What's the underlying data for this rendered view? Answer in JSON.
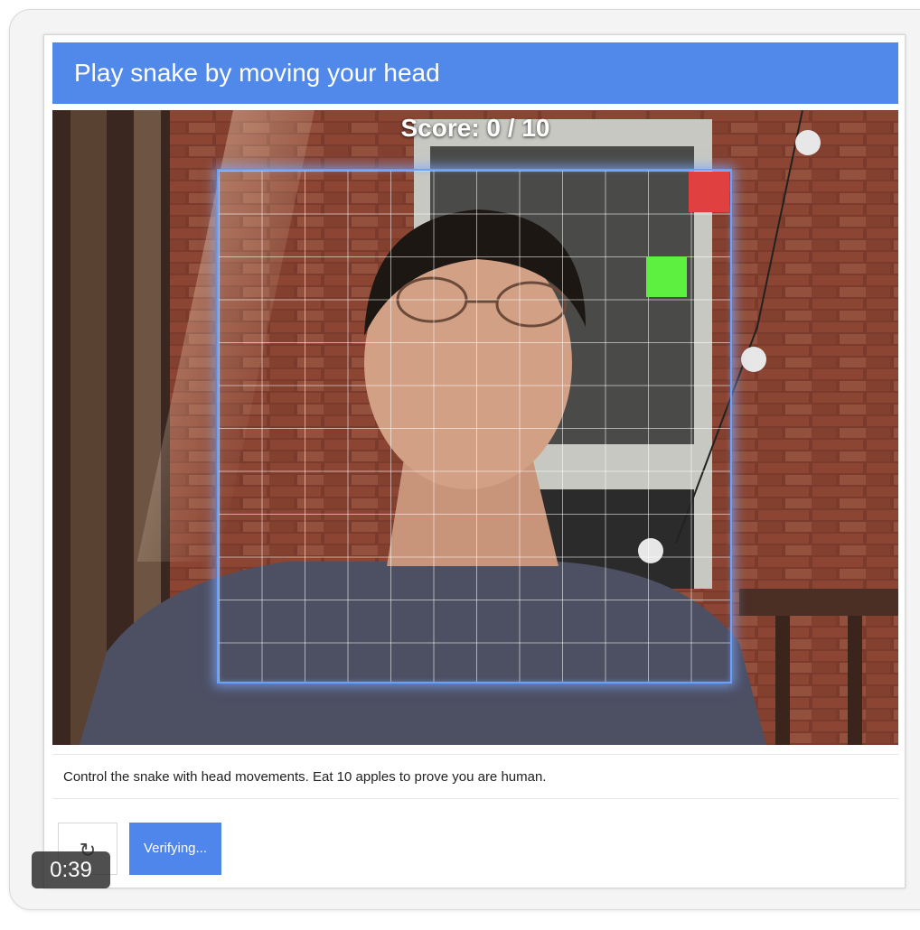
{
  "header": {
    "title": "Play snake by moving your head"
  },
  "game": {
    "score_text": "Score: 0 / 10",
    "score": 0,
    "target": 10,
    "grid_size": 12,
    "apple": {
      "col": 11,
      "row": 0,
      "color": "#e04040"
    },
    "snake": [
      {
        "col": 10,
        "row": 2,
        "color": "#5ef040"
      }
    ]
  },
  "instructions": {
    "text": "Control the snake with head movements. Eat 10 apples to prove you are human."
  },
  "footer": {
    "refresh_icon": "↻",
    "verify_label": "Verifying..."
  },
  "video": {
    "timestamp": "0:39"
  },
  "colors": {
    "accent": "#5089e9",
    "button": "#4f86ec"
  }
}
